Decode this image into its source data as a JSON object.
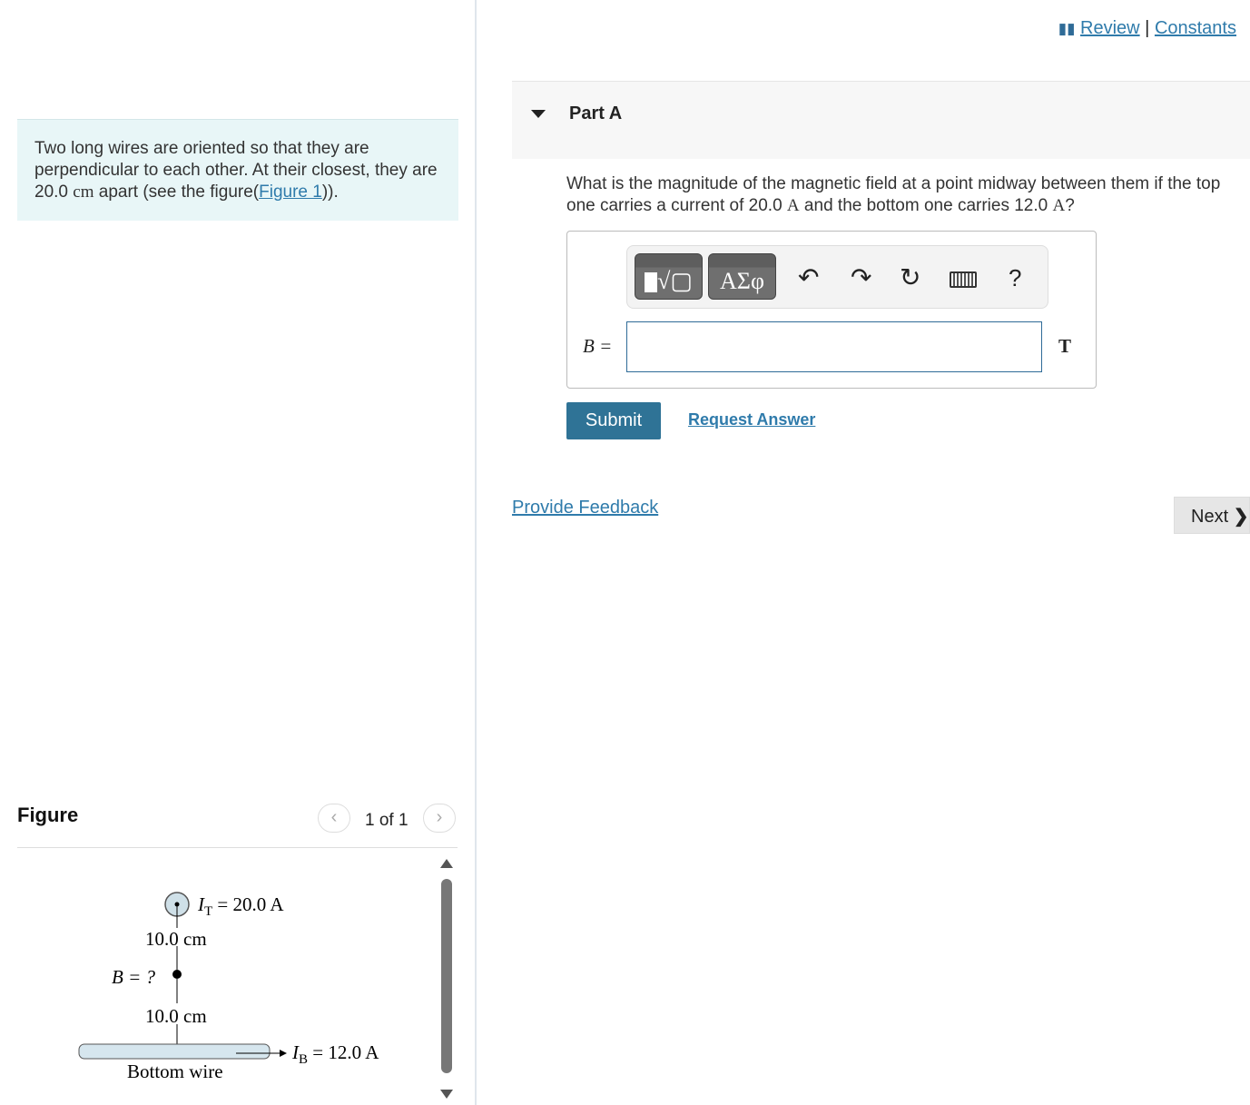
{
  "intro": {
    "text_before": "Two long wires are oriented so that they are perpendicular to each other. At their closest, they are 20.0 ",
    "unit": "cm",
    "text_after": " apart (see the figure(",
    "link": "Figure 1",
    "text_end": "))."
  },
  "figure": {
    "title": "Figure",
    "count": "1 of 1",
    "labels": {
      "top_current": "I",
      "top_sub": "T",
      "top_value": " = 20.0 A",
      "dist1": "10.0 cm",
      "b": "B = ?",
      "dist2": "10.0 cm",
      "bottom_current": "I",
      "bottom_sub": "B",
      "bottom_value": " = 12.0 A",
      "bottom_wire": "Bottom wire"
    }
  },
  "header": {
    "review": "Review",
    "separator": "|",
    "constants": "Constants"
  },
  "part": {
    "title": "Part A",
    "question_a": "What is the magnitude of the magnetic field at a point midway between them if the top one carries a current of 20.0 ",
    "q_unit1": "A",
    "question_b": " and the bottom one carries 12.0 ",
    "q_unit2": "A",
    "question_c": "?"
  },
  "answer": {
    "label": "B =",
    "value": "",
    "unit": "T",
    "toolbar": {
      "greek": "ΑΣφ",
      "help": "?"
    }
  },
  "actions": {
    "submit": "Submit",
    "request": "Request Answer",
    "feedback": "Provide Feedback",
    "next": "Next"
  }
}
